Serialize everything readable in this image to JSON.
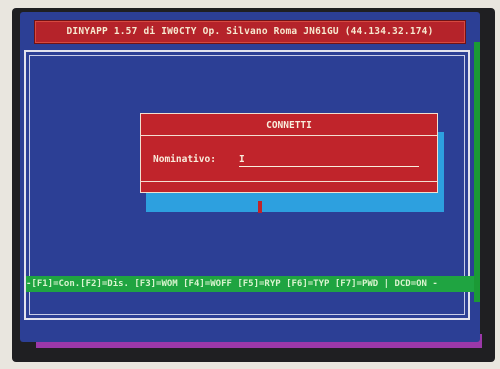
{
  "window": {
    "title": "DINYAPP 1.57 di IW0CTY Op. Silvano Roma JN61GU (44.134.32.174)"
  },
  "dialog": {
    "title": "CONNETTI",
    "field_label": "Nominativo:",
    "field_value": "I"
  },
  "statusbar": {
    "text": "-[F1]=Con.[F2]=Dis. [F3]=WOM [F4]=WOFF [F5]=RYP [F6]=TYP [F7]=PWD | DCD=ON -"
  },
  "colors": {
    "screen_bg": "#2c3f95",
    "title_bg": "#b5232a",
    "dialog_bg": "#c0242b",
    "status_bg": "#1fa441",
    "shadow": "#2da0df"
  }
}
